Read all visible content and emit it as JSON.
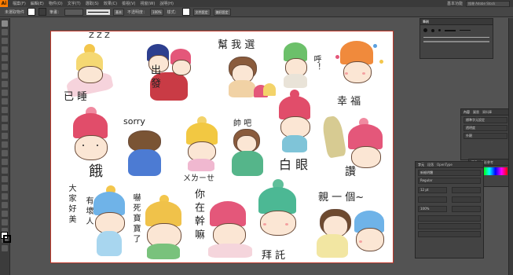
{
  "app": {
    "logo": "Ai"
  },
  "menubar": {
    "items": [
      "檔案(F)",
      "編輯(E)",
      "物件(O)",
      "文字(T)",
      "選取(S)",
      "效果(C)",
      "檢視(V)",
      "視窗(W)",
      "說明(H)"
    ],
    "workspace": "基本功能",
    "search_placeholder": "搜尋 Adobe Stock"
  },
  "control_bar": {
    "selection_label": "未選取物件",
    "stroke_label": "筆畫：",
    "stroke_weight": "",
    "brush_label": "基本",
    "opacity_label": "不透明度：",
    "opacity_value": "100%",
    "style_label": "樣式：",
    "doc_setup": "文件設定",
    "prefs": "偏好設定"
  },
  "artboard": {
    "texts": {
      "zzz": "Z Z Z",
      "sleep": "已 睡",
      "depart": "出 發",
      "help": "幫 我 選",
      "hu": "呼！",
      "happy": "幸 福",
      "sorry": "sorry",
      "handsome": "帥 吧",
      "hungry": "餓",
      "wuliao": "ㄨㄌㄧㄝ",
      "eyeroll": "白 眼",
      "praise": "讚",
      "kiss": "親 一 個~",
      "everyone": "大 家 好 美",
      "creep": "有 壞 人",
      "cry": "嚇 死 寶 寶 了",
      "doing": "你 在 幹 嘛",
      "speak": "拜 託"
    }
  },
  "panels": {
    "brush_panel_tab": "筆刷",
    "props_tabs": [
      "內容",
      "圖層",
      "資料庫"
    ],
    "props_rows": [
      "標準字元設定",
      "透明度",
      "外觀"
    ],
    "color_tabs": [
      "顏色",
      "色彩參考"
    ],
    "char_tabs": [
      "字元",
      "段落",
      "OpenType"
    ],
    "char_rows": [
      "新細明體",
      "Regular",
      "12 pt",
      "100%"
    ]
  },
  "colors": {
    "artboard_border": "#c0392b",
    "ui_dark": "#3a3a3a",
    "canvas": "#535353"
  }
}
